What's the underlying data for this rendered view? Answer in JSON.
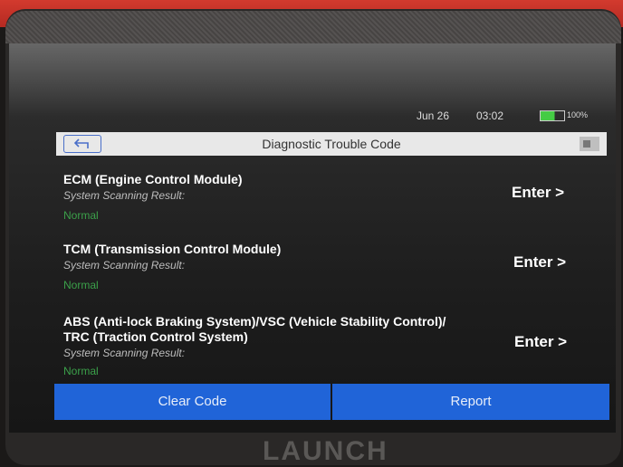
{
  "status_bar": {
    "date": "Jun 26",
    "time": "03:02",
    "battery": "100%"
  },
  "header": {
    "title": "Diagnostic Trouble Code"
  },
  "modules": [
    {
      "name": "ECM (Engine Control Module)",
      "result_label": "System Scanning Result:",
      "status": "Normal",
      "enter": "Enter >"
    },
    {
      "name": "TCM (Transmission Control Module)",
      "result_label": "System Scanning Result:",
      "status": "Normal",
      "enter": "Enter >"
    },
    {
      "name_line1": "ABS (Anti-lock Braking System)/VSC (Vehicle Stability Control)/",
      "name_line2": "TRC (Traction Control System)",
      "result_label": "System Scanning Result:",
      "status": "Normal",
      "enter": "Enter >"
    }
  ],
  "footer": {
    "clear_label": "Clear Code",
    "report_label": "Report"
  },
  "brand": "LAUNCH",
  "colors": {
    "accent": "#2064d8",
    "normal": "#3ba04a",
    "device_red": "#c8322a"
  },
  "icons": {
    "back": "back-arrow-icon",
    "menu": "menu-icon",
    "battery": "battery-icon"
  }
}
